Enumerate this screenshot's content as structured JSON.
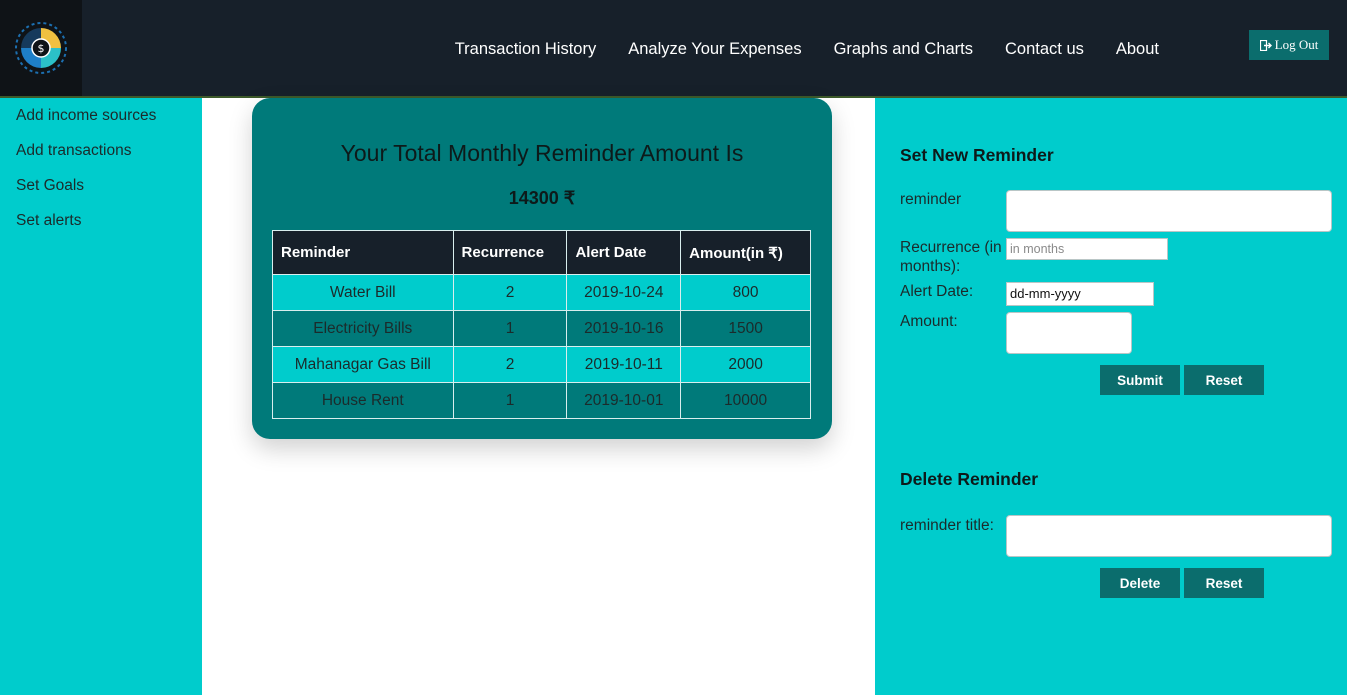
{
  "colors": {
    "nav_bg": "#17202a",
    "accent": "#00cccc",
    "card_bg": "#007a7a",
    "button_bg": "#0b6d6d"
  },
  "nav": {
    "links": [
      "Transaction History",
      "Analyze Your Expenses",
      "Graphs and Charts",
      "Contact us",
      "About"
    ],
    "logout_label": "Log Out",
    "logout_icon": "sign-out-icon"
  },
  "sidebar": {
    "items": [
      "Add income sources",
      "Add transactions",
      "Set Goals",
      "Set alerts"
    ]
  },
  "summary": {
    "title": "Your Total Monthly Reminder Amount Is",
    "amount": "14300 ₹"
  },
  "table": {
    "headers": [
      "Reminder",
      "Recurrence",
      "Alert Date",
      "Amount(in ₹)"
    ],
    "rows": [
      [
        "Water Bill",
        "2",
        "2019-10-24",
        "800"
      ],
      [
        "Electricity Bills",
        "1",
        "2019-10-16",
        "1500"
      ],
      [
        "Mahanagar Gas Bill",
        "2",
        "2019-10-11",
        "2000"
      ],
      [
        "House Rent",
        "1",
        "2019-10-01",
        "10000"
      ]
    ]
  },
  "new_reminder": {
    "title": "Set New Reminder",
    "reminder_label": "reminder",
    "recurrence_label": "Recurrence (in months):",
    "recurrence_placeholder": "in months",
    "alert_label": "Alert Date:",
    "alert_value": "dd-mm-yyyy",
    "amount_label": "Amount:",
    "submit_label": "Submit",
    "reset_label": "Reset"
  },
  "delete_reminder": {
    "title": "Delete Reminder",
    "title_label": "reminder title:",
    "delete_label": "Delete",
    "reset_label": "Reset"
  }
}
